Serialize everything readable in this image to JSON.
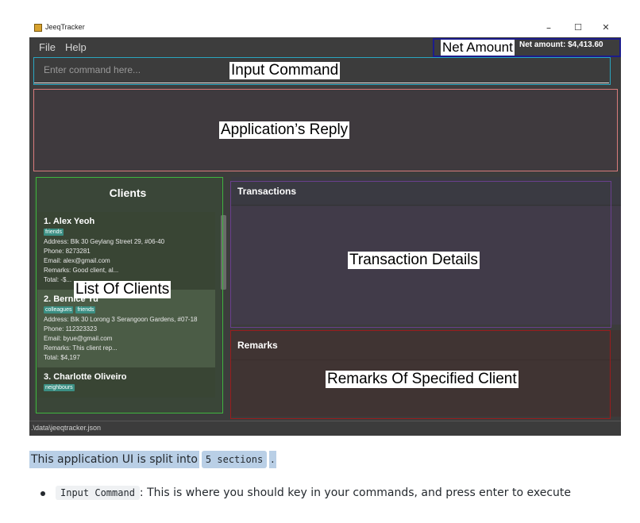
{
  "window": {
    "title": "JeeqTracker",
    "controls": {
      "minimize": "–",
      "maximize": "☐",
      "close": "✕"
    }
  },
  "menu": {
    "file": "File",
    "help": "Help"
  },
  "net_amount": "Net amount: $4,413.60",
  "command": {
    "placeholder": "Enter command here..."
  },
  "clients": {
    "header": "Clients",
    "items": [
      {
        "name": "1.  Alex Yeoh",
        "tags": [
          "friends"
        ],
        "address": "Address: Blk 30 Geylang Street 29, #06-40",
        "phone": "Phone: 8273281",
        "email": "Email: alex@gmail.com",
        "remarks": "Remarks: Good client, al...",
        "total": "Total: -$..."
      },
      {
        "name": "2.  Bernice Yu",
        "tags": [
          "colleagues",
          "friends"
        ],
        "address": "Address: Blk 30 Lorong 3 Serangoon Gardens, #07-18",
        "phone": "Phone: 112323323",
        "email": "Email: byue@gmail.com",
        "remarks": "Remarks: This client rep...",
        "total": "Total: $4,197"
      },
      {
        "name": "3.  Charlotte Oliveiro",
        "tags": [
          "neighbours"
        ]
      }
    ]
  },
  "transactions": {
    "header": "Transactions"
  },
  "remarks": {
    "header": "Remarks"
  },
  "status": {
    "path": ".\\data\\jeeqtracker.json"
  },
  "annotations": {
    "net_amount": "Net Amount",
    "input_command": "Input Command",
    "app_reply": "Application’s Reply",
    "list_clients": "List Of Clients",
    "transaction_details": "Transaction Details",
    "remarks_client": "Remarks Of Specified Client"
  },
  "annotation_colors": {
    "net_amount": "#1c1c8c",
    "input_command": "#2aa6c0",
    "app_reply": "#d77b7b",
    "list_clients": "#3fb63f",
    "transaction_details": "#6a3f8e",
    "remarks_client": "#9a1c1c"
  },
  "doc": {
    "intro": "This application UI is split into",
    "sections_code": "5 sections",
    "intro_end": ".",
    "bullet_code": "Input Command",
    "bullet_text": ": This is where you should key in your commands, and press enter to execute"
  }
}
